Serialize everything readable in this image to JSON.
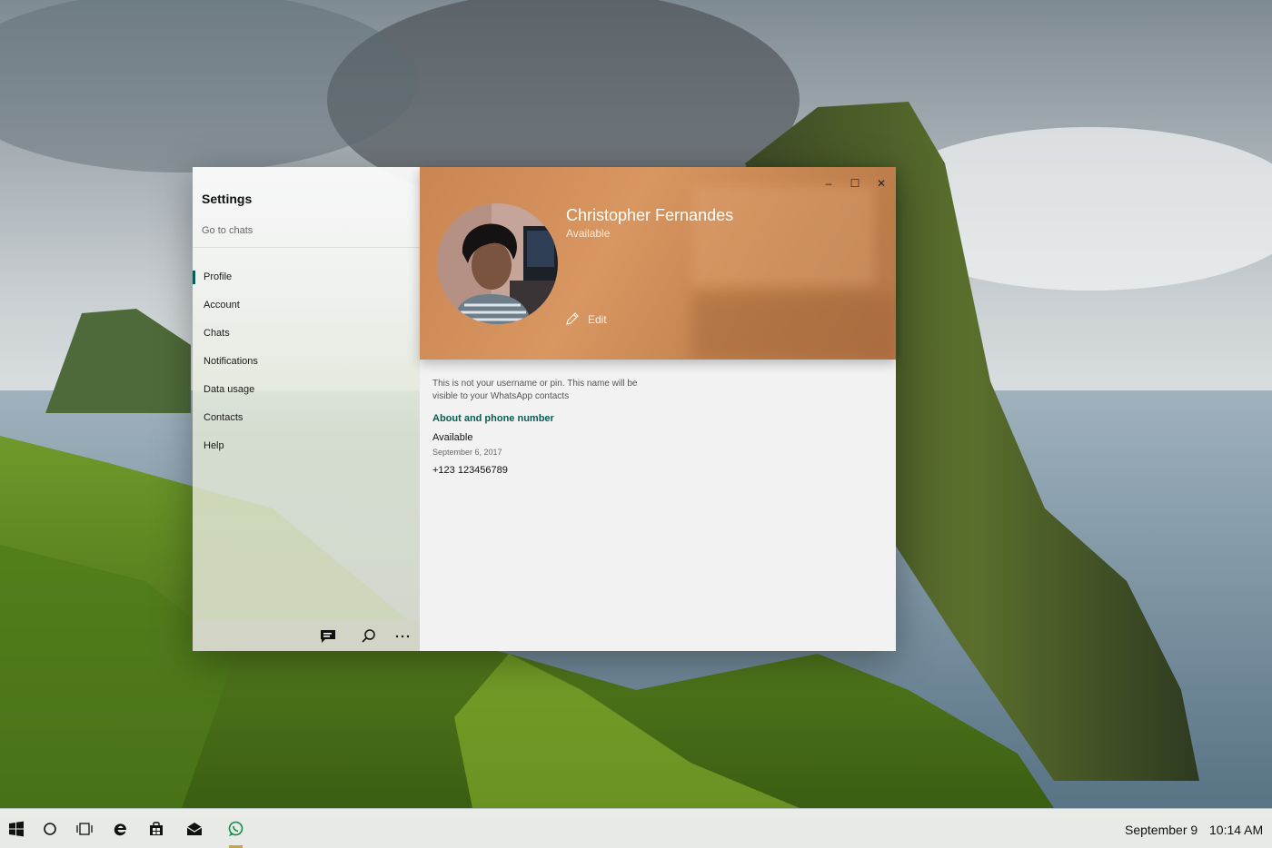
{
  "window": {
    "sidebar_title": "Settings",
    "go_to_chats": "Go to chats",
    "nav_items": [
      {
        "label": "Profile",
        "active": true
      },
      {
        "label": "Account"
      },
      {
        "label": "Chats"
      },
      {
        "label": "Notifications"
      },
      {
        "label": "Data usage"
      },
      {
        "label": "Contacts"
      },
      {
        "label": "Help"
      }
    ],
    "controls": {
      "minimize": "–",
      "maximize": "☐",
      "close": "✕"
    }
  },
  "profile": {
    "name": "Christopher Fernandes",
    "status": "Available",
    "edit_label": "Edit",
    "note": "This is not your username or pin. This name will be visible to your WhatsApp contacts",
    "section_title": "About and phone number",
    "about": "Available",
    "about_date": "September 6, 2017",
    "phone": "+123 123456789"
  },
  "taskbar": {
    "date": "September 9",
    "time": "10:14 AM"
  },
  "colors": {
    "accent": "#075e54",
    "header": "#c98552"
  }
}
